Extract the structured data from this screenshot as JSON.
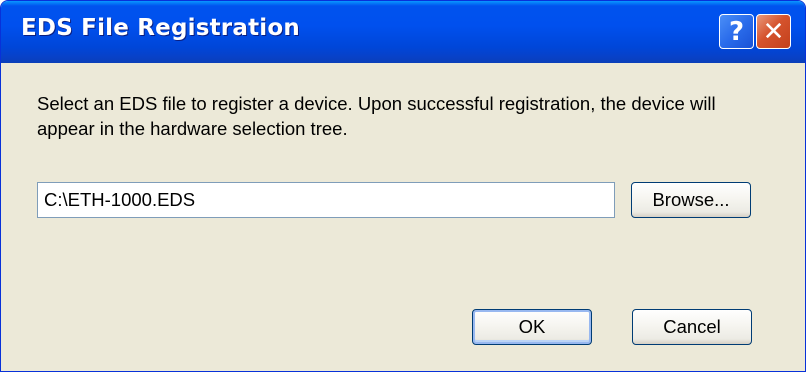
{
  "window": {
    "title": "EDS File Registration",
    "help_glyph": "?",
    "close_glyph": "✕"
  },
  "dialog": {
    "description": "Select an EDS file to register a device. Upon successful registration, the device will appear in the hardware selection tree.",
    "file_path": "C:\\ETH-1000.EDS",
    "browse_label": "Browse...",
    "ok_label": "OK",
    "cancel_label": "Cancel"
  },
  "colors": {
    "titlebar": "#0054E3",
    "client_background": "#ECE9D8",
    "close_button": "#D5532D",
    "help_button": "#2A6CEB"
  },
  "icons": {
    "help": "help-icon",
    "close": "close-icon"
  }
}
